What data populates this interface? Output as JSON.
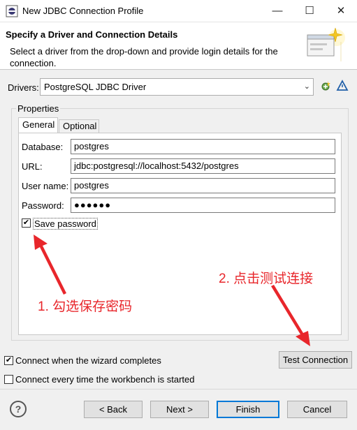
{
  "window": {
    "title": "New JDBC Connection Profile",
    "minimize": "—",
    "maximize": "☐",
    "close": "✕"
  },
  "header": {
    "title": "Specify a Driver and Connection Details",
    "description": "Select a driver from the drop-down and provide login details for the connection."
  },
  "drivers": {
    "label": "Drivers:",
    "value": "PostgreSQL JDBC Driver"
  },
  "properties": {
    "group_label": "Properties",
    "tabs": [
      "General",
      "Optional"
    ],
    "fields": {
      "database": {
        "label": "Database:",
        "value": "postgres"
      },
      "url": {
        "label": "URL:",
        "value": "jdbc:postgresql://localhost:5432/postgres"
      },
      "username": {
        "label": "User name:",
        "value": "postgres"
      },
      "password": {
        "label": "Password:",
        "value": "●●●●●●"
      }
    },
    "save_password": {
      "label": "Save password",
      "checked": true
    }
  },
  "annotations": {
    "step1": "1. 勾选保存密码",
    "step2": "2. 点击测试连接"
  },
  "options": {
    "connect_on_finish": {
      "label": "Connect when the wizard completes",
      "checked": true
    },
    "connect_every_time": {
      "label": "Connect every time the workbench is started",
      "checked": false
    }
  },
  "buttons": {
    "test_connection": "Test Connection",
    "back": "< Back",
    "next": "Next >",
    "finish": "Finish",
    "cancel": "Cancel",
    "help": "?"
  },
  "colors": {
    "annotation_red": "#e8262b",
    "focus_blue": "#0078d7"
  }
}
